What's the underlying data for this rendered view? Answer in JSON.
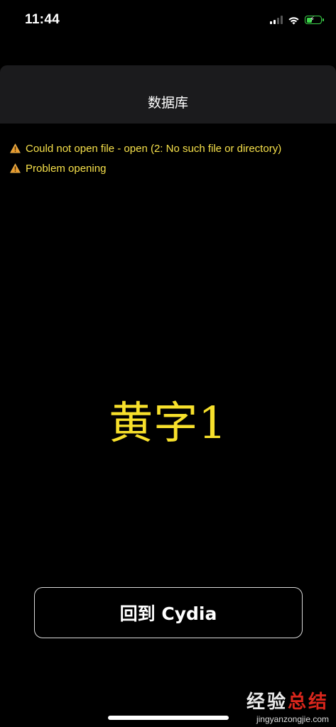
{
  "status_bar": {
    "time": "11:44",
    "signal_icon": "cellular-signal-icon",
    "wifi_icon": "wifi-icon",
    "battery_icon": "battery-charging-icon",
    "battery_color": "#3cd64a"
  },
  "nav": {
    "title": "数据库"
  },
  "messages": [
    {
      "icon": "warning-icon",
      "text": "Could not open file - open (2: No such file or directory)"
    },
    {
      "icon": "warning-icon",
      "text": "Problem opening"
    }
  ],
  "content": {
    "big_text": "黄字1",
    "text_color": "#f7e02b"
  },
  "actions": {
    "back_label": "回到 Cydia"
  },
  "watermark": {
    "main_a": "经验",
    "main_b": "总结",
    "url": "jingyanzongjie.com"
  }
}
